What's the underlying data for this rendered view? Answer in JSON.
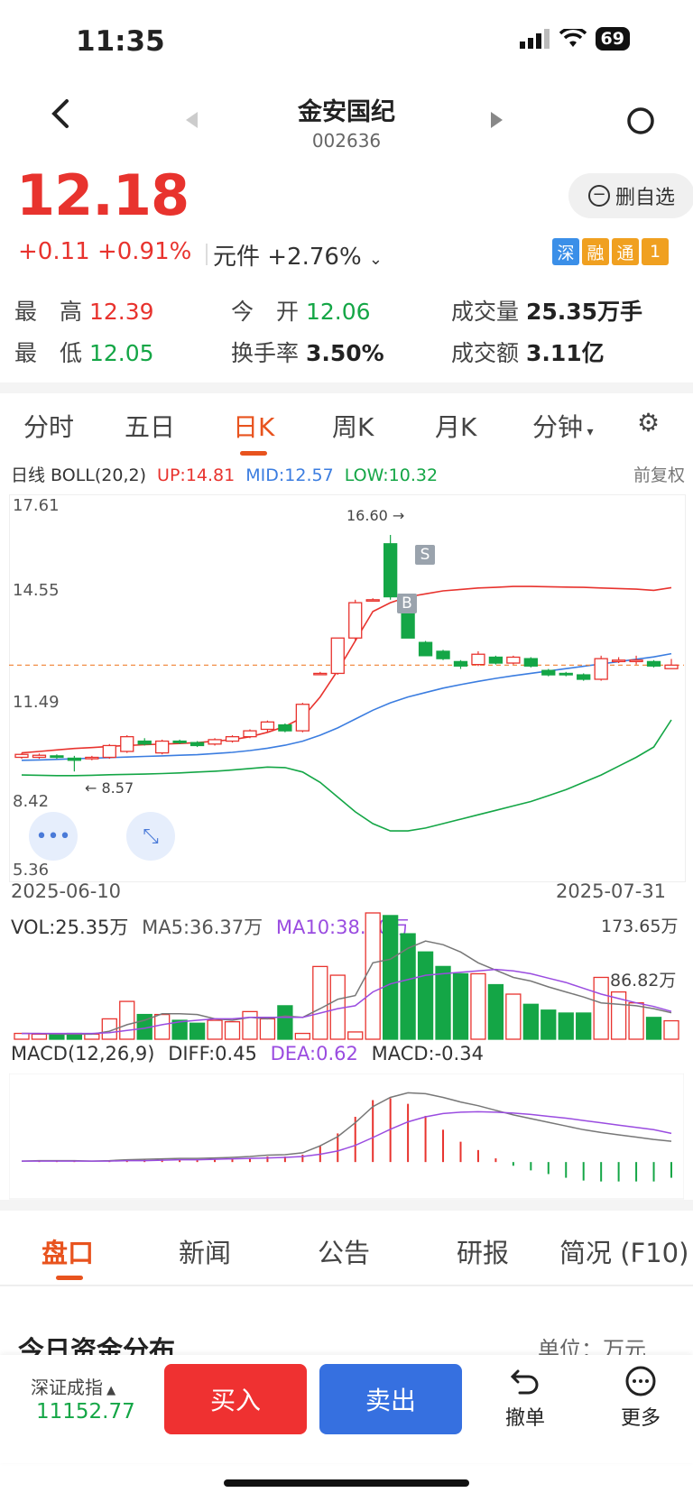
{
  "status": {
    "time": "11:35",
    "battery": "69"
  },
  "header": {
    "title": "金安国纪",
    "code": "002636"
  },
  "quote": {
    "price": "12.18",
    "change": "+0.11 +0.91%",
    "sector_change": "元件 +2.76%",
    "delete_label": "删自选",
    "badges": [
      "深",
      "融",
      "通",
      "1"
    ],
    "stats": {
      "high_label": "最　高",
      "high": "12.39",
      "open_label": "今　开",
      "open": "12.06",
      "volume_label": "成交量",
      "volume": "25.35万手",
      "low_label": "最　低",
      "low": "12.05",
      "turnover_label": "换手率",
      "turnover": "3.50%",
      "amount_label": "成交额",
      "amount": "3.11亿"
    }
  },
  "kline_tabs": [
    "分时",
    "五日",
    "日K",
    "周K",
    "月K",
    "分钟"
  ],
  "active_kline_tab": "日K",
  "boll": {
    "label": "日线 BOLL(20,2)",
    "up": "UP:14.81",
    "mid": "MID:12.57",
    "low": "LOW:10.32",
    "right": "前复权"
  },
  "price_axis": [
    "17.61",
    "14.55",
    "11.49",
    "8.42",
    "5.36"
  ],
  "markers": {
    "high": "16.60",
    "low": "8.57",
    "buy": "B",
    "sell": "S"
  },
  "dates": {
    "start": "2025-06-10",
    "end": "2025-07-31"
  },
  "volume": {
    "vol": "VOL:25.35万",
    "ma5": "MA5:36.37万",
    "ma10": "MA10:38.20万",
    "max": "173.65万",
    "mid": "86.82万"
  },
  "macd": {
    "label": "MACD(12,26,9)",
    "diff": "DIFF:0.45",
    "dea": "DEA:0.62",
    "macd": "MACD:-0.34"
  },
  "bottom_tabs": [
    "盘口",
    "新闻",
    "公告",
    "研报",
    "简况 (F10)"
  ],
  "section": {
    "title": "今日资金分布",
    "unit": "单位：万元"
  },
  "bottom_bar": {
    "index_name": "深证成指",
    "index_value": "11152.77",
    "buy": "买入",
    "sell": "卖出",
    "undo": "撤单",
    "more": "更多"
  },
  "colors": {
    "up": "#e8332e",
    "down": "#14a646",
    "accent": "#e8531e",
    "mid_line": "#3b7de0",
    "ma10": "#9a4ce0"
  },
  "chart_data": {
    "type": "candlestick",
    "ylim": [
      5.36,
      17.61
    ],
    "candles": [
      {
        "o": 9.05,
        "c": 9.15,
        "h": 9.2,
        "l": 9.0
      },
      {
        "o": 9.05,
        "c": 9.12,
        "h": 9.18,
        "l": 9.0
      },
      {
        "o": 9.1,
        "c": 9.05,
        "h": 9.15,
        "l": 9.0
      },
      {
        "o": 9.02,
        "c": 8.95,
        "h": 9.1,
        "l": 8.57
      },
      {
        "o": 9.0,
        "c": 9.05,
        "h": 9.1,
        "l": 8.95
      },
      {
        "o": 9.05,
        "c": 9.45,
        "h": 9.5,
        "l": 9.0
      },
      {
        "o": 9.25,
        "c": 9.75,
        "h": 9.8,
        "l": 9.2
      },
      {
        "o": 9.6,
        "c": 9.5,
        "h": 9.7,
        "l": 9.45
      },
      {
        "o": 9.2,
        "c": 9.6,
        "h": 9.65,
        "l": 9.15
      },
      {
        "o": 9.6,
        "c": 9.55,
        "h": 9.65,
        "l": 9.5
      },
      {
        "o": 9.55,
        "c": 9.45,
        "h": 9.6,
        "l": 9.4
      },
      {
        "o": 9.5,
        "c": 9.65,
        "h": 9.7,
        "l": 9.45
      },
      {
        "o": 9.6,
        "c": 9.75,
        "h": 9.8,
        "l": 9.55
      },
      {
        "o": 9.75,
        "c": 9.95,
        "h": 10.0,
        "l": 9.7
      },
      {
        "o": 10.0,
        "c": 10.25,
        "h": 10.3,
        "l": 9.9
      },
      {
        "o": 10.15,
        "c": 9.95,
        "h": 10.2,
        "l": 9.9
      },
      {
        "o": 9.95,
        "c": 10.85,
        "h": 10.9,
        "l": 9.9
      },
      {
        "o": 11.9,
        "c": 11.9,
        "h": 11.95,
        "l": 11.85
      },
      {
        "o": 11.9,
        "c": 13.1,
        "h": 13.1,
        "l": 11.85
      },
      {
        "o": 13.1,
        "c": 14.3,
        "h": 14.4,
        "l": 13.0
      },
      {
        "o": 14.4,
        "c": 14.4,
        "h": 14.45,
        "l": 14.35
      },
      {
        "o": 16.3,
        "c": 14.5,
        "h": 16.6,
        "l": 14.4
      },
      {
        "o": 14.4,
        "c": 13.1,
        "h": 14.5,
        "l": 13.1
      },
      {
        "o": 12.95,
        "c": 12.5,
        "h": 13.0,
        "l": 12.5
      },
      {
        "o": 12.65,
        "c": 12.4,
        "h": 12.7,
        "l": 12.35
      },
      {
        "o": 12.3,
        "c": 12.15,
        "h": 12.35,
        "l": 12.05
      },
      {
        "o": 12.2,
        "c": 12.55,
        "h": 12.65,
        "l": 12.15
      },
      {
        "o": 12.45,
        "c": 12.25,
        "h": 12.5,
        "l": 12.2
      },
      {
        "o": 12.25,
        "c": 12.45,
        "h": 12.5,
        "l": 12.2
      },
      {
        "o": 12.4,
        "c": 12.15,
        "h": 12.45,
        "l": 12.1
      },
      {
        "o": 12.0,
        "c": 11.85,
        "h": 12.05,
        "l": 11.8
      },
      {
        "o": 11.9,
        "c": 11.85,
        "h": 11.95,
        "l": 11.8
      },
      {
        "o": 11.85,
        "c": 11.7,
        "h": 11.9,
        "l": 11.65
      },
      {
        "o": 11.7,
        "c": 12.4,
        "h": 12.5,
        "l": 11.65
      },
      {
        "o": 12.3,
        "c": 12.35,
        "h": 12.45,
        "l": 12.25
      },
      {
        "o": 12.3,
        "c": 12.35,
        "h": 12.5,
        "l": 12.2
      },
      {
        "o": 12.3,
        "c": 12.15,
        "h": 12.35,
        "l": 12.1
      },
      {
        "o": 12.06,
        "c": 12.18,
        "h": 12.39,
        "l": 12.05
      }
    ],
    "boll_up": [
      9.2,
      9.25,
      9.3,
      9.35,
      9.38,
      9.42,
      9.45,
      9.48,
      9.5,
      9.52,
      9.55,
      9.6,
      9.65,
      9.75,
      9.9,
      10.1,
      10.4,
      11.1,
      12.0,
      13.0,
      14.0,
      14.3,
      14.5,
      14.6,
      14.7,
      14.75,
      14.8,
      14.82,
      14.85,
      14.85,
      14.84,
      14.83,
      14.82,
      14.8,
      14.78,
      14.76,
      14.72,
      14.81
    ],
    "boll_mid": [
      8.95,
      8.96,
      8.98,
      9.0,
      9.02,
      9.04,
      9.06,
      9.08,
      9.1,
      9.12,
      9.14,
      9.18,
      9.22,
      9.28,
      9.36,
      9.46,
      9.6,
      9.8,
      10.05,
      10.35,
      10.65,
      10.9,
      11.1,
      11.25,
      11.4,
      11.52,
      11.63,
      11.73,
      11.82,
      11.9,
      11.98,
      12.06,
      12.14,
      12.22,
      12.3,
      12.38,
      12.46,
      12.57
    ],
    "boll_low": [
      8.45,
      8.44,
      8.43,
      8.43,
      8.44,
      8.46,
      8.47,
      8.48,
      8.5,
      8.52,
      8.55,
      8.58,
      8.62,
      8.67,
      8.72,
      8.7,
      8.55,
      8.2,
      7.7,
      7.2,
      6.8,
      6.55,
      6.55,
      6.65,
      6.8,
      6.95,
      7.1,
      7.25,
      7.4,
      7.55,
      7.75,
      7.95,
      8.2,
      8.45,
      8.75,
      9.05,
      9.4,
      10.32
    ],
    "volume_max": 173.65,
    "volume": [
      8,
      7,
      6,
      8,
      7,
      28,
      52,
      34,
      34,
      26,
      22,
      26,
      24,
      38,
      28,
      46,
      8,
      100,
      88,
      10,
      173.65,
      170,
      145,
      120,
      100,
      90,
      90,
      75,
      62,
      48,
      40,
      36,
      36,
      85,
      65,
      50,
      30,
      25.35
    ],
    "ma5": [
      8,
      8,
      7,
      7,
      7,
      11,
      20,
      26,
      35,
      35,
      34,
      28,
      26,
      30,
      28,
      32,
      30,
      42,
      55,
      60,
      105,
      110,
      125,
      135,
      130,
      120,
      105,
      95,
      85,
      80,
      72,
      65,
      58,
      50,
      48,
      46,
      42,
      36.37
    ],
    "ma10": [
      8,
      8,
      8,
      8,
      8,
      9,
      12,
      15,
      20,
      24,
      26,
      28,
      28,
      30,
      30,
      30,
      30,
      36,
      42,
      46,
      65,
      76,
      82,
      88,
      90,
      92,
      94,
      96,
      94,
      90,
      84,
      78,
      70,
      62,
      56,
      50,
      45,
      38.2
    ],
    "macd_range": [
      -0.7,
      1.8
    ],
    "diff": [
      0.02,
      0.03,
      0.03,
      0.03,
      0.02,
      0.03,
      0.05,
      0.06,
      0.07,
      0.08,
      0.08,
      0.09,
      0.1,
      0.12,
      0.15,
      0.16,
      0.2,
      0.35,
      0.55,
      0.85,
      1.2,
      1.4,
      1.5,
      1.48,
      1.4,
      1.3,
      1.22,
      1.12,
      1.02,
      0.94,
      0.86,
      0.78,
      0.7,
      0.64,
      0.59,
      0.54,
      0.49,
      0.45
    ],
    "dea": [
      0.02,
      0.02,
      0.02,
      0.02,
      0.02,
      0.02,
      0.03,
      0.03,
      0.04,
      0.05,
      0.05,
      0.06,
      0.07,
      0.08,
      0.09,
      0.1,
      0.12,
      0.17,
      0.24,
      0.36,
      0.53,
      0.71,
      0.87,
      0.98,
      1.05,
      1.08,
      1.09,
      1.08,
      1.06,
      1.03,
      0.99,
      0.95,
      0.9,
      0.85,
      0.8,
      0.75,
      0.7,
      0.62
    ],
    "macd_bar": [
      0.0,
      0.02,
      0.02,
      0.02,
      0.0,
      0.02,
      0.04,
      0.06,
      0.06,
      0.06,
      0.06,
      0.06,
      0.06,
      0.08,
      0.12,
      0.12,
      0.16,
      0.36,
      0.62,
      0.98,
      1.34,
      1.38,
      1.26,
      1.0,
      0.7,
      0.44,
      0.26,
      0.08,
      -0.08,
      -0.18,
      -0.26,
      -0.34,
      -0.4,
      -0.42,
      -0.42,
      -0.42,
      -0.42,
      -0.34
    ]
  }
}
